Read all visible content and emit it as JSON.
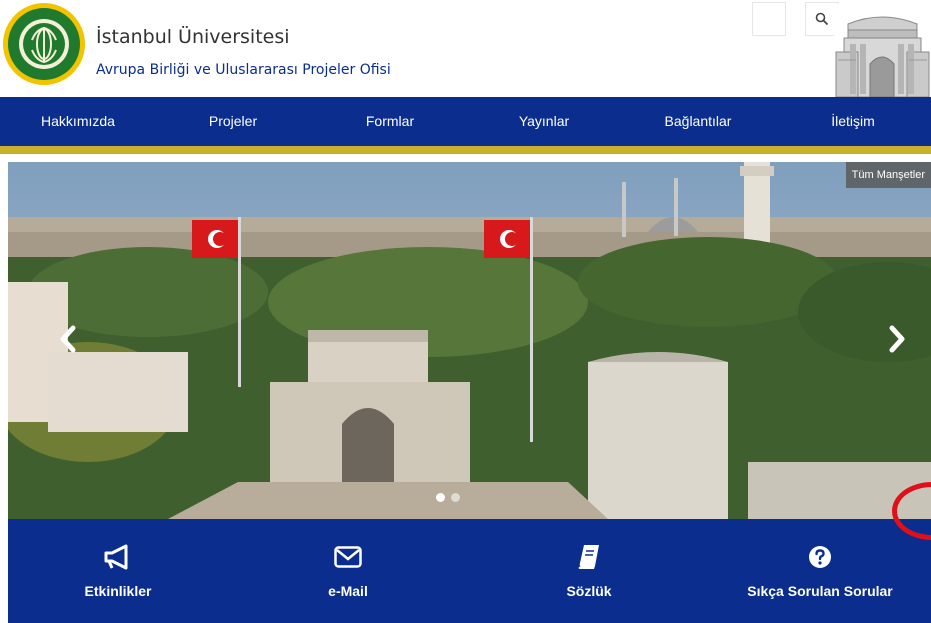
{
  "header": {
    "title": "İstanbul Üniversitesi",
    "subtitle": "Avrupa Birliği ve Uluslararası Projeler Ofisi",
    "logo_icon": "university-seal-icon",
    "search_icon": "search-icon",
    "building_icon": "university-gate-icon"
  },
  "nav": {
    "items": [
      {
        "label": "Hakkımızda"
      },
      {
        "label": "Projeler"
      },
      {
        "label": "Formlar"
      },
      {
        "label": "Yayınlar"
      },
      {
        "label": "Bağlantılar"
      },
      {
        "label": "İletişim"
      }
    ]
  },
  "slider": {
    "all_headlines_label": "Tüm Manşetler",
    "prev_icon": "chevron-left-icon",
    "next_icon": "chevron-right-icon",
    "slide_count": 2,
    "active_slide": 1
  },
  "quick_links": [
    {
      "label": "Etkinlikler",
      "icon": "megaphone-icon"
    },
    {
      "label": "e-Mail",
      "icon": "envelope-icon"
    },
    {
      "label": "Sözlük",
      "icon": "book-icon"
    },
    {
      "label": "Sıkça Sorulan Sorular",
      "icon": "question-circle-icon"
    }
  ],
  "colors": {
    "primary": "#0b2d8e",
    "accent": "#c8b128",
    "annotation": "#e0101a"
  }
}
